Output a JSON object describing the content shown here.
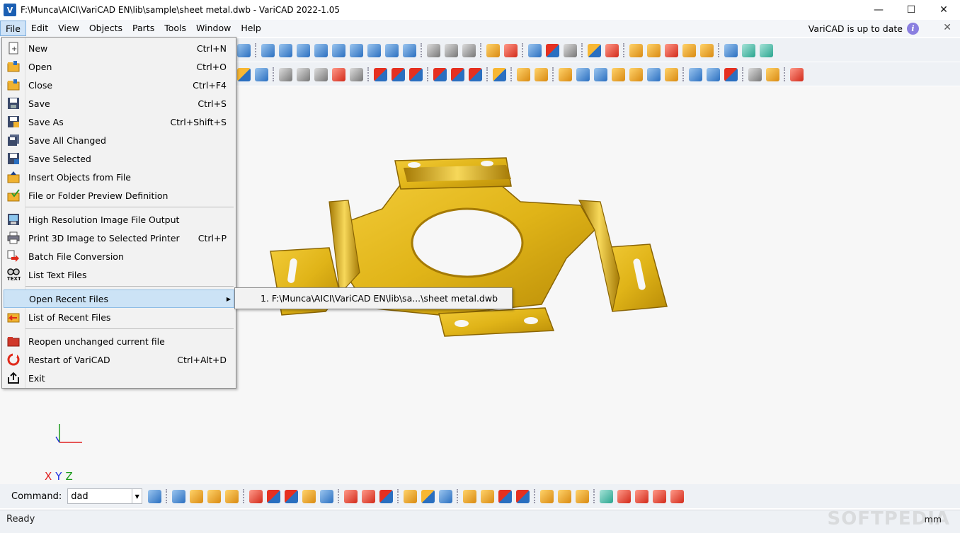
{
  "window": {
    "logo": "V",
    "title": "F:\\Munca\\AICI\\VariCAD EN\\lib\\sample\\sheet metal.dwb - VariCAD 2022-1.05",
    "minimize": "—",
    "maximize": "☐",
    "close": "✕"
  },
  "menubar": {
    "items": [
      "File",
      "Edit",
      "View",
      "Objects",
      "Parts",
      "Tools",
      "Window",
      "Help"
    ],
    "update_status": "VariCAD is up to date",
    "info": "i",
    "close": "✕"
  },
  "file_menu": {
    "items": [
      {
        "label": "New",
        "shortcut": "Ctrl+N"
      },
      {
        "label": "Open",
        "shortcut": "Ctrl+O"
      },
      {
        "label": "Close",
        "shortcut": "Ctrl+F4"
      },
      {
        "label": "Save",
        "shortcut": "Ctrl+S"
      },
      {
        "label": "Save As",
        "shortcut": "Ctrl+Shift+S"
      },
      {
        "label": "Save All Changed",
        "shortcut": ""
      },
      {
        "label": "Save Selected",
        "shortcut": ""
      },
      {
        "label": "Insert Objects from File",
        "shortcut": ""
      },
      {
        "label": "File or Folder Preview Definition",
        "shortcut": ""
      },
      {
        "label": "High Resolution Image File Output",
        "shortcut": ""
      },
      {
        "label": "Print 3D Image to Selected Printer",
        "shortcut": "Ctrl+P"
      },
      {
        "label": "Batch File Conversion",
        "shortcut": ""
      },
      {
        "label": "List Text Files",
        "shortcut": ""
      },
      {
        "label": "Open Recent Files",
        "shortcut": ""
      },
      {
        "label": "List of Recent Files",
        "shortcut": ""
      },
      {
        "label": "Reopen unchanged current file",
        "shortcut": ""
      },
      {
        "label": "Restart of VariCAD",
        "shortcut": "Ctrl+Alt+D"
      },
      {
        "label": "Exit",
        "shortcut": ""
      }
    ],
    "text_icon_label": "TEXT"
  },
  "recent_submenu": {
    "items": [
      "1. F:\\Munca\\AICI\\VariCAD EN\\lib\\sa...\\sheet metal.dwb"
    ]
  },
  "axis": {
    "x": "X",
    "y": "Y",
    "z": "Z"
  },
  "command": {
    "label": "Command:",
    "value": "dad"
  },
  "status": {
    "text": "Ready",
    "units": "mm",
    "watermark": "SOFTPEDIA"
  },
  "colors": {
    "part_fill": "#e0b418",
    "part_shadow": "#a57a05",
    "menu_highlight": "#cce3f6",
    "canvas_bg": "#f7f7f7"
  }
}
